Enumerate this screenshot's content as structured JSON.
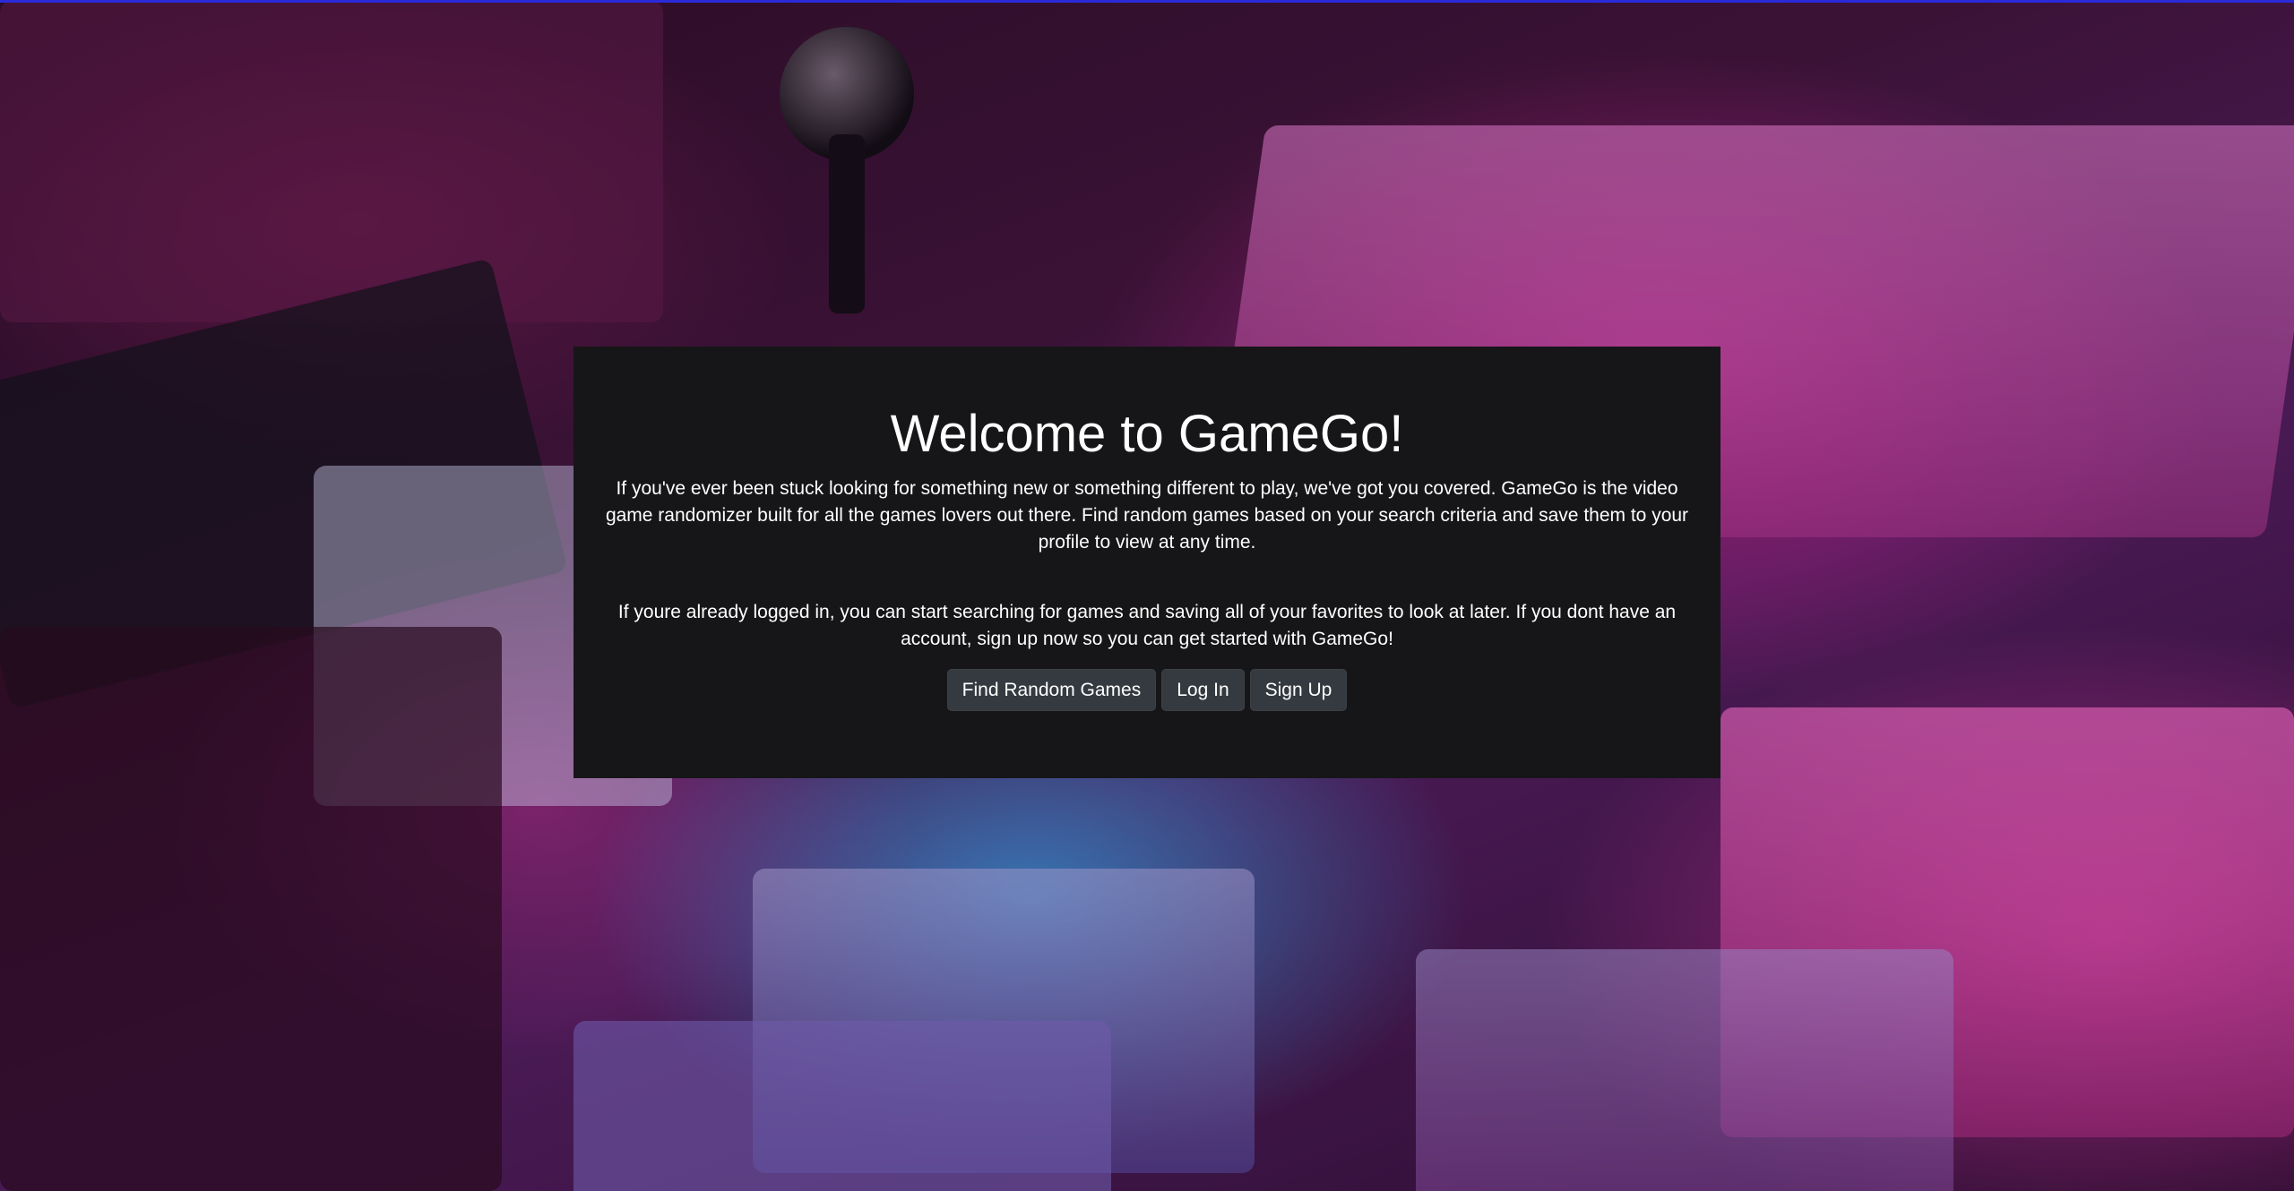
{
  "hero": {
    "title": "Welcome to GameGo!",
    "intro": "If you've ever been stuck looking for something new or something different to play, we've got you covered. GameGo is the video game randomizer built for all the games lovers out there. Find random games based on your search criteria and save them to your profile to view at any time.",
    "account_text": "If youre already logged in, you can start searching for games and saving all of your favorites to look at later. If you dont have an account, sign up now so you can get started with GameGo!"
  },
  "buttons": {
    "find_random": "Find Random Games",
    "log_in": "Log In",
    "sign_up": "Sign Up"
  },
  "colors": {
    "panel": "#161618",
    "button": "#343a40",
    "accent_top": "#2a2ad8"
  }
}
